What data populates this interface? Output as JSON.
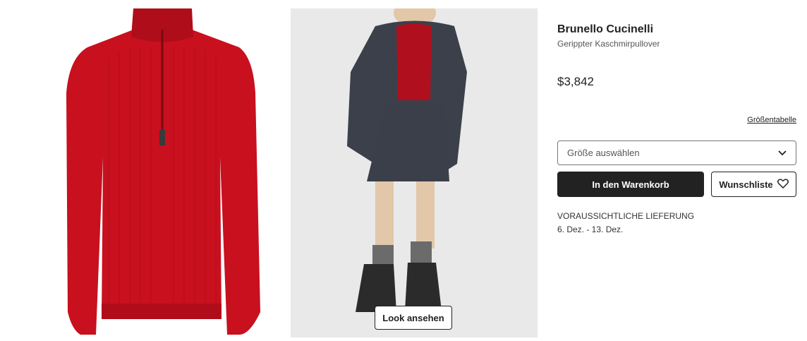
{
  "product": {
    "brand": "Brunello Cucinelli",
    "subtitle": "Gerippter Kaschmirpullover",
    "price": "$3,842"
  },
  "gallery": {
    "look_button_label": "Look ansehen",
    "sweater_color": "#c8101e",
    "background_color": "#e9e9e9"
  },
  "size": {
    "chart_link": "Größentabelle",
    "select_placeholder": "Größe auswählen"
  },
  "actions": {
    "cart_label": "In den Warenkorb",
    "wishlist_label": "Wunschliste"
  },
  "delivery": {
    "label": "VORAUSSICHTLICHE LIEFERUNG",
    "dates": "6. Dez. - 13. Dez."
  }
}
